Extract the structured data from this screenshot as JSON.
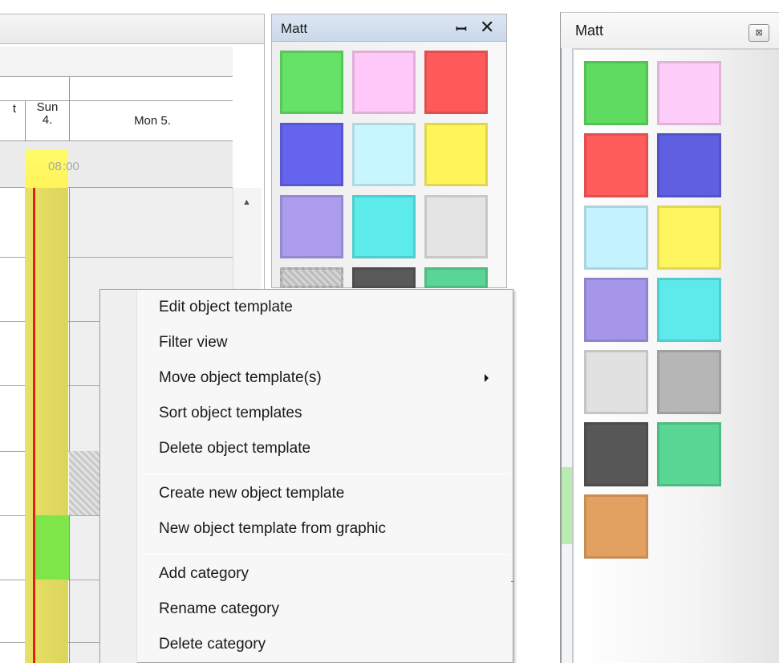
{
  "scheduler": {
    "day_partial": "t",
    "day_sun_line1": "Sun",
    "day_sun_line2": "4.",
    "day_mon": "Mon 5.",
    "time_label_a": "08",
    "time_label_b": ":00",
    "scroll_up_icon": "triangle-up"
  },
  "dock_palette": {
    "title": "Matt",
    "pin_icon": "pin-icon",
    "close_icon": "close-icon",
    "swatches": [
      "#66e266",
      "#ffc8f8",
      "#ff5a5a",
      "#6464ee",
      "#c8f6ff",
      "#fff55a",
      "#ac9cee",
      "#5ceaea",
      "#e4e4e4",
      "#c6c6c6",
      "#595959",
      "#5ad596"
    ]
  },
  "context_menu": {
    "items": [
      "Edit object template",
      "Filter view",
      "Move object template(s)",
      "Sort object templates",
      "Delete object template",
      "Create new object template",
      "New object template from graphic",
      "Add category",
      "Rename category",
      "Delete category"
    ],
    "submenu_icon": "submenu-arrow-icon"
  },
  "float_palette": {
    "title": "Matt",
    "close_icon": "restore-close-icon",
    "swatches": [
      "#5fdc5f",
      "#ffcdf9",
      "#ff5c5c",
      "#5f5fe2",
      "#c4f2ff",
      "#fff55e",
      "#a596ea",
      "#5eeaea",
      "#e1e1e1",
      "#b6b6b6",
      "#575757",
      "#59d693",
      "#e2a160"
    ]
  },
  "colors": {
    "today_yellow": "#f0e860",
    "now_line_red": "#e02020",
    "dock_title_blue": "#cfdcec"
  }
}
